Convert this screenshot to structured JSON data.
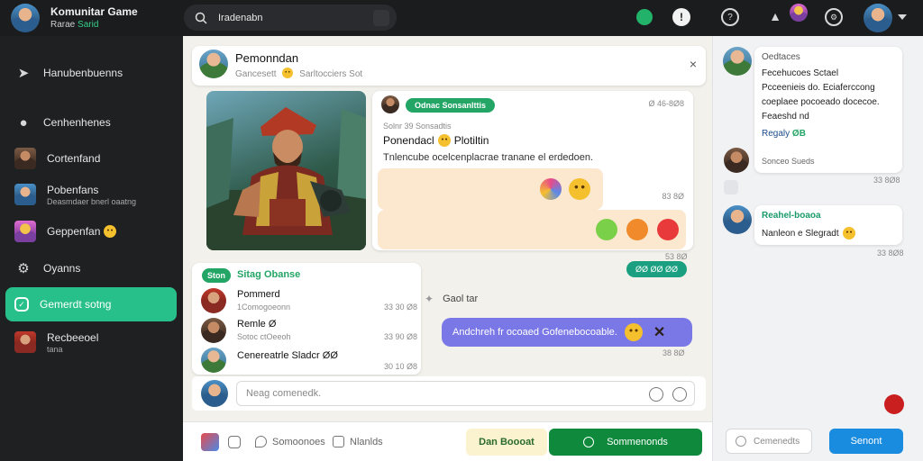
{
  "app": {
    "title": "Komunitar Game",
    "subtitle_prefix": "Rarae",
    "subtitle_accent": "Sarid"
  },
  "search": {
    "value": "Iradenabn"
  },
  "sidebar": {
    "items": [
      {
        "label": "Hanubenbuenns"
      },
      {
        "label": "Cenhenhenes"
      },
      {
        "label": "Cortenfand"
      },
      {
        "label": "Pobenfans",
        "sub": "Deasmdaer bnerl oaatng"
      },
      {
        "label": "Geppenfan"
      },
      {
        "label": "Oyanns"
      },
      {
        "label": "Gemerdt sotng"
      },
      {
        "label": "Recbeeoel",
        "sub": "tana"
      }
    ],
    "accent": "#27c08a"
  },
  "conversation": {
    "name": "Pemonndan",
    "status_a": "Gancesett",
    "status_b": "Sarltocciers Sot",
    "close_glyph": "×"
  },
  "post": {
    "tag": "Odnac Sonsanlttis",
    "time": "Ø 46-8Ø8",
    "meta": "Solnr 39 Sonsadtis",
    "title": "Ponendacl",
    "title_suffix": "Plotiltin",
    "body": "Tnlencube ocelcenplacrae tranane el erdedoen.",
    "reply_time": "83 8Ø",
    "reply_time2": "53 8Ø"
  },
  "highlight": {
    "tag": "Ston",
    "title": "Sitag Obanse",
    "rows": [
      {
        "name": "Pommerd",
        "sub": "1Comogoeonn",
        "time": "33 30 Ø8"
      },
      {
        "name": "Remle Ø",
        "sub": "Sotoc ctOeeoh",
        "time": "33 90 Ø8"
      },
      {
        "name": "Cenereatrle Sladcr ØØ",
        "sub": "",
        "time": "30 10 Ø8"
      }
    ]
  },
  "messages": {
    "badge": "ØØ ØØ ØØ",
    "other_text": "Gaol tar",
    "own_text": "Andchreh fr ocoaed Gofenebocoable.",
    "own_time": "38 8Ø"
  },
  "composer": {
    "placeholder": "Neag comenedk."
  },
  "bottombar": {
    "tab_a": "Somoonoes",
    "tab_b": "Nlanlds",
    "soft_label": "Dan Boooat",
    "primary_label": "Sommenonds"
  },
  "right": {
    "messages": [
      {
        "name": "Oedtaces",
        "lines": [
          "Fecehucoes Sctael",
          "Pcceenieis do. Eciaferccong",
          "coeplaee pocoeado docecoe.",
          "Feaeshd nd"
        ],
        "footer": "Regaly",
        "footer_accent": "ØB",
        "time": "33 8Ø8"
      },
      {
        "name": "Sonceo Sueds",
        "lines": [],
        "footer": "",
        "footer_accent": "",
        "time": ""
      },
      {
        "name": "Reahel-boaoa",
        "lines": [
          "Nanleon e Slegradt"
        ],
        "footer": "",
        "footer_accent": "",
        "time": "33 8Ø8"
      }
    ],
    "input_placeholder": "Cemenedts",
    "send_label": "Senont",
    "send_color": "#1a8cdf"
  }
}
